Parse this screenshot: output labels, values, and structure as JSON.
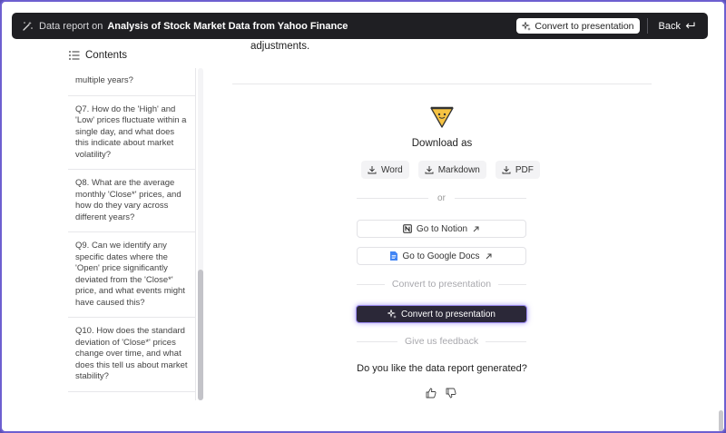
{
  "topbar": {
    "prefix": "Data report on",
    "title": "Analysis of Stock Market Data from Yahoo Finance",
    "convert_label": "Convert to presentation",
    "back_label": "Back"
  },
  "sidebar": {
    "header": "Contents",
    "items": [
      {
        "label": "multiple years?"
      },
      {
        "label": "Q7. How do the 'High' and 'Low' prices fluctuate within a single day, and what does this indicate about market volatility?"
      },
      {
        "label": "Q8. What are the average monthly 'Close*' prices, and how do they vary across different years?"
      },
      {
        "label": "Q9. Can we identify any specific dates where the 'Open' price significantly deviated from the 'Close*' price, and what events might have caused this?"
      },
      {
        "label": "Q10. How does the standard deviation of 'Close*' prices change over time, and what does this tell us about market stability?"
      }
    ]
  },
  "main": {
    "top_text": "adjustments.",
    "download_label": "Download as",
    "download_buttons": {
      "word": "Word",
      "markdown": "Markdown",
      "pdf": "PDF"
    },
    "or_label": "or",
    "notion_label": "Go to Notion",
    "gdocs_label": "Go to Google Docs",
    "convert_section_label": "Convert to presentation",
    "convert_button_label": "Convert to presentation",
    "feedback_section_label": "Give us feedback",
    "feedback_question": "Do you like the data report generated?"
  },
  "colors": {
    "topbar_bg": "#1f1f23",
    "accent": "#9b8af0",
    "logo_yellow": "#f6c343"
  }
}
